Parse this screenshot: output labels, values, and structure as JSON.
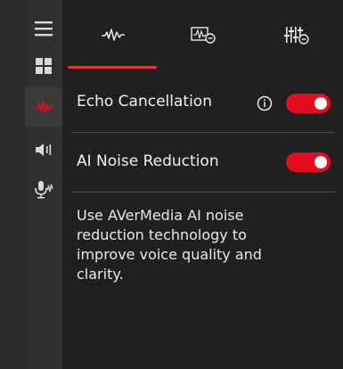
{
  "sidebar": {
    "items": [
      {
        "icon": "menu-icon"
      },
      {
        "icon": "grid-icon"
      },
      {
        "icon": "waveform-icon",
        "active": true
      },
      {
        "icon": "speaker-icon"
      },
      {
        "icon": "microphone-icon"
      }
    ]
  },
  "tabs": [
    {
      "icon": "waveform-tab-icon",
      "active": true
    },
    {
      "icon": "noise-filter-tab-icon"
    },
    {
      "icon": "equalizer-tab-icon"
    }
  ],
  "settings": {
    "echo_cancellation": {
      "label": "Echo Cancellation",
      "enabled": true
    },
    "ai_noise_reduction": {
      "label": "AI Noise Reduction",
      "enabled": true
    },
    "description": "Use AVerMedia AI noise reduction technology to improve voice quality and clarity."
  },
  "colors": {
    "accent": "#e30b1c",
    "background": "#202020",
    "sidebar": "#2f2f2f"
  }
}
